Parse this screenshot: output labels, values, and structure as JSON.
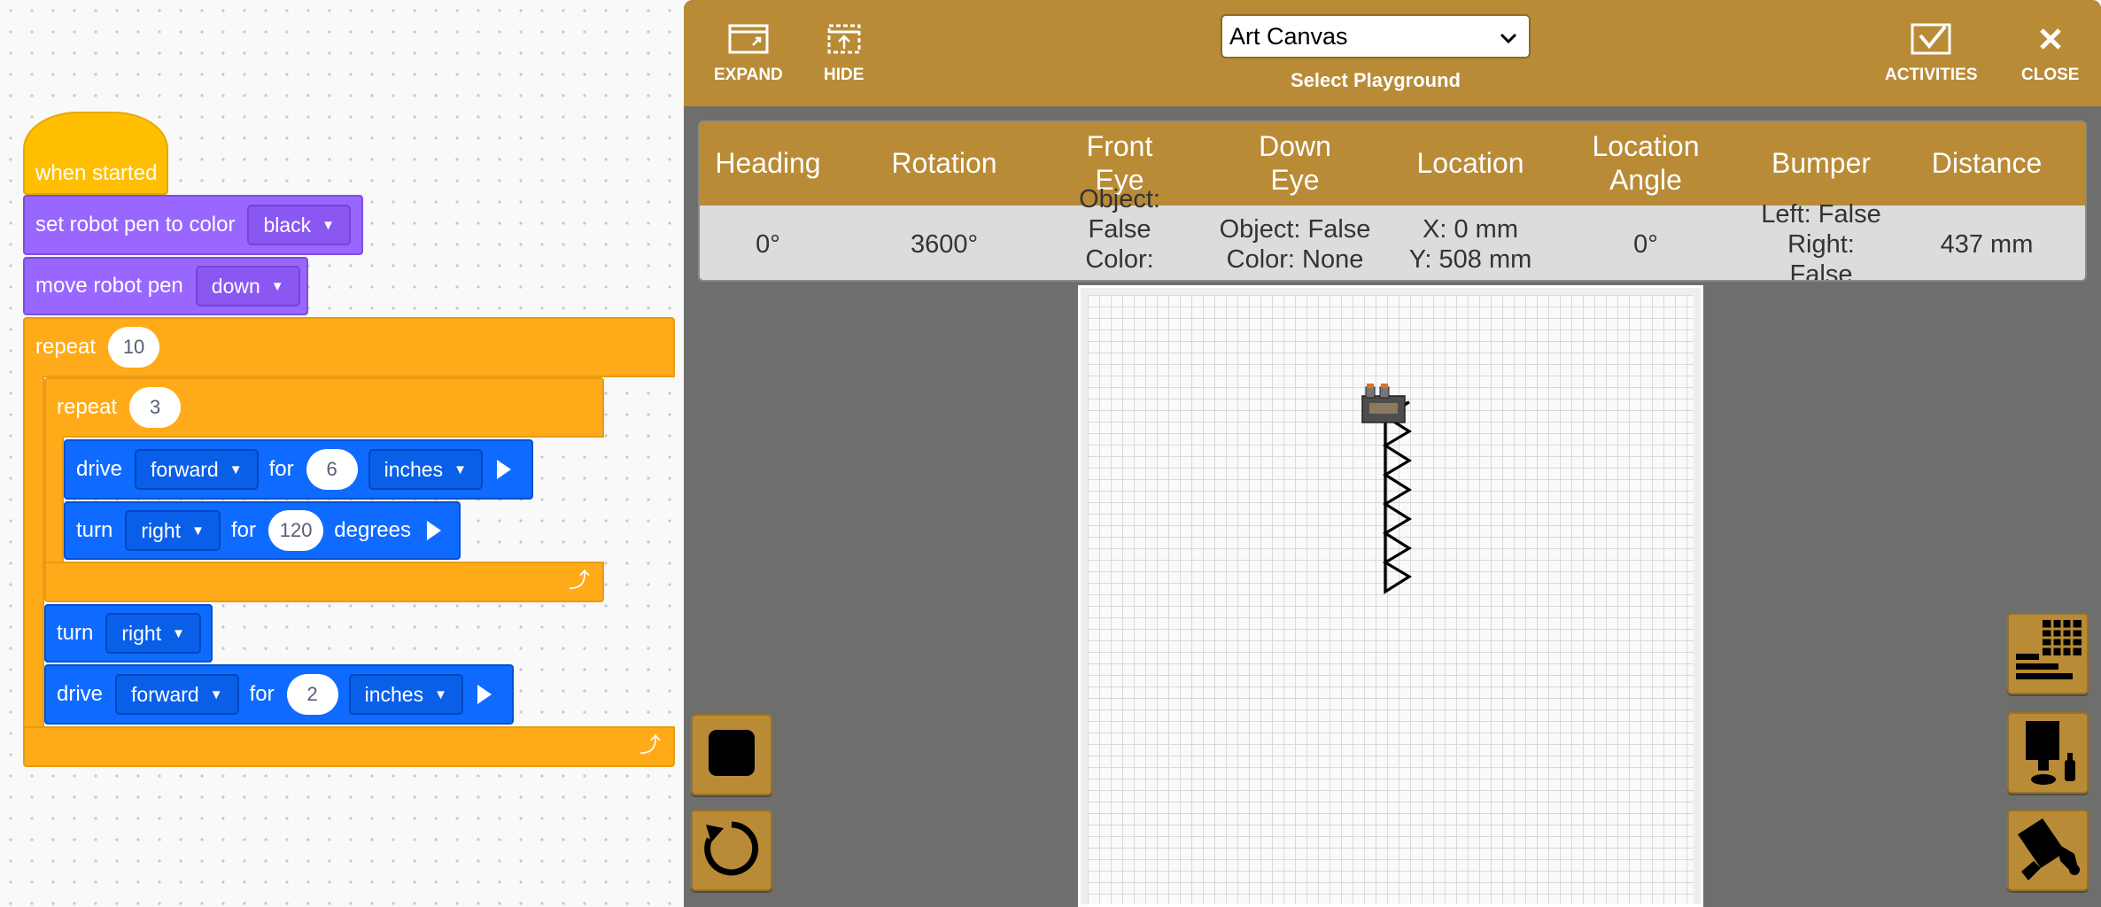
{
  "workspace": {
    "when_started": "when started",
    "set_pen": {
      "label": "set robot pen to color",
      "color": "black"
    },
    "move_pen": {
      "label": "move robot pen",
      "direction": "down"
    },
    "repeat_outer": {
      "label": "repeat",
      "count": "10"
    },
    "repeat_inner": {
      "label": "repeat",
      "count": "3"
    },
    "drive1": {
      "label": "drive",
      "direction": "forward",
      "for": "for",
      "amount": "6",
      "unit": "inches"
    },
    "turn1": {
      "label": "turn",
      "direction": "right",
      "for": "for",
      "amount": "120",
      "unit": "degrees"
    },
    "turn2": {
      "label": "turn",
      "direction": "right"
    },
    "drive2": {
      "label": "drive",
      "direction": "forward",
      "for": "for",
      "amount": "2",
      "unit": "inches"
    }
  },
  "toolbar": {
    "expand": "EXPAND",
    "hide": "HIDE",
    "playground_value": "Art Canvas",
    "playground_label": "Select Playground",
    "activities": "ACTIVITIES",
    "close": "CLOSE"
  },
  "sensors": {
    "headers": [
      "Heading",
      "Rotation",
      "Front\nEye",
      "Down\nEye",
      "Location",
      "Location\nAngle",
      "Bumper",
      "Distance"
    ],
    "values": [
      "0°",
      "3600°",
      "Object: False\nColor: None",
      "Object: False\nColor: None",
      "X: 0 mm\nY: 508 mm",
      "0°",
      "Left: False\nRight: False",
      "437 mm"
    ]
  },
  "colors": {
    "gold": "#b98b36",
    "events": "#ffbf00",
    "looks": "#9966ff",
    "control": "#ffab19",
    "motion": "#0f6bff",
    "panel": "#6e6e6c"
  },
  "icons": {
    "expand": "expand-icon",
    "hide": "hide-icon",
    "activities": "activities-icon",
    "close": "close-icon",
    "stop": "stop-icon",
    "reset": "reset-icon",
    "table": "table-icon",
    "robot": "robot-icon",
    "camera": "camera-icon"
  }
}
